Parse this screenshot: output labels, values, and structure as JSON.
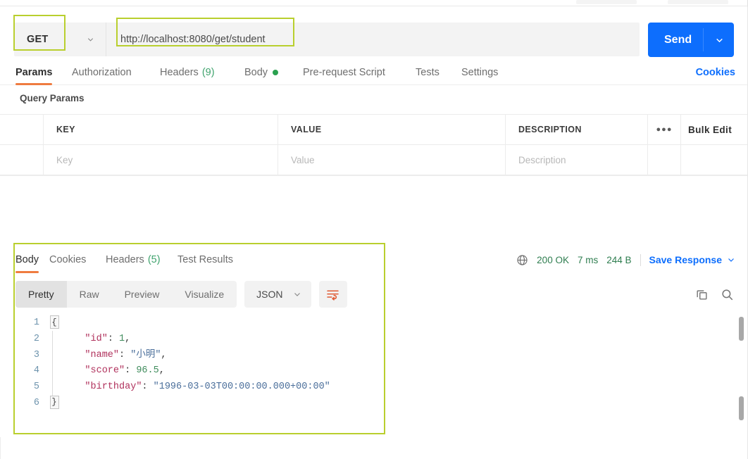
{
  "request": {
    "method": "GET",
    "url": "http://localhost:8080/get/student",
    "send_label": "Send",
    "tabs": [
      {
        "label": "Params",
        "count": null,
        "dot": false,
        "active": true
      },
      {
        "label": "Authorization",
        "count": null,
        "dot": false,
        "active": false
      },
      {
        "label": "Headers",
        "count": "(9)",
        "dot": false,
        "active": false
      },
      {
        "label": "Body",
        "count": null,
        "dot": true,
        "active": false
      },
      {
        "label": "Pre-request Script",
        "count": null,
        "dot": false,
        "active": false
      },
      {
        "label": "Tests",
        "count": null,
        "dot": false,
        "active": false
      },
      {
        "label": "Settings",
        "count": null,
        "dot": false,
        "active": false
      }
    ],
    "cookies_link": "Cookies"
  },
  "query_params": {
    "title": "Query Params",
    "columns": [
      "",
      "KEY",
      "VALUE",
      "DESCRIPTION"
    ],
    "dots_label": "●●●",
    "bulk_edit_label": "Bulk Edit",
    "rows": [
      {
        "key": "Key",
        "value": "Value",
        "description": "Description",
        "placeholder": true
      }
    ]
  },
  "response": {
    "tabs": [
      {
        "label": "Body",
        "count": null,
        "active": true
      },
      {
        "label": "Cookies",
        "count": null,
        "active": false
      },
      {
        "label": "Headers",
        "count": "(5)",
        "active": false
      },
      {
        "label": "Test Results",
        "count": null,
        "active": false
      }
    ],
    "status": {
      "globe_icon": "globe-icon",
      "code": "200 OK",
      "time": "7 ms",
      "size": "244 B"
    },
    "save_response_label": "Save Response",
    "view_modes": [
      {
        "label": "Pretty",
        "active": true
      },
      {
        "label": "Raw",
        "active": false
      },
      {
        "label": "Preview",
        "active": false
      },
      {
        "label": "Visualize",
        "active": false
      }
    ],
    "format": "JSON",
    "wrap_icon": "wrap-text-icon",
    "copy_icon": "copy-icon",
    "search_icon": "search-icon",
    "body_lines": [
      {
        "num": "1",
        "fold": "{",
        "tokens": []
      },
      {
        "num": "2",
        "fold": null,
        "tokens": [
          {
            "t": "key",
            "v": "    \"id\""
          },
          {
            "t": "pun",
            "v": ": "
          },
          {
            "t": "num",
            "v": "1"
          },
          {
            "t": "pun",
            "v": ","
          }
        ]
      },
      {
        "num": "3",
        "fold": null,
        "tokens": [
          {
            "t": "key",
            "v": "    \"name\""
          },
          {
            "t": "pun",
            "v": ": "
          },
          {
            "t": "str",
            "v": "\"小明\""
          },
          {
            "t": "pun",
            "v": ","
          }
        ]
      },
      {
        "num": "4",
        "fold": null,
        "tokens": [
          {
            "t": "key",
            "v": "    \"score\""
          },
          {
            "t": "pun",
            "v": ": "
          },
          {
            "t": "num",
            "v": "96.5"
          },
          {
            "t": "pun",
            "v": ","
          }
        ]
      },
      {
        "num": "5",
        "fold": null,
        "tokens": [
          {
            "t": "key",
            "v": "    \"birthday\""
          },
          {
            "t": "pun",
            "v": ": "
          },
          {
            "t": "str",
            "v": "\"1996-03-03T00:00:00.000+00:00\""
          }
        ]
      },
      {
        "num": "6",
        "fold": "}",
        "tokens": []
      }
    ]
  },
  "colors": {
    "accent_blue": "#0d6efd",
    "tab_underline": "#ef7c40",
    "status_green": "#2e7d4f",
    "count_green": "#3fa36d",
    "highlight": "#b9cf2e",
    "json_key": "#b0315c",
    "json_number": "#3f8c5c",
    "json_string": "#4b6f9b",
    "line_number": "#6d93ad"
  }
}
